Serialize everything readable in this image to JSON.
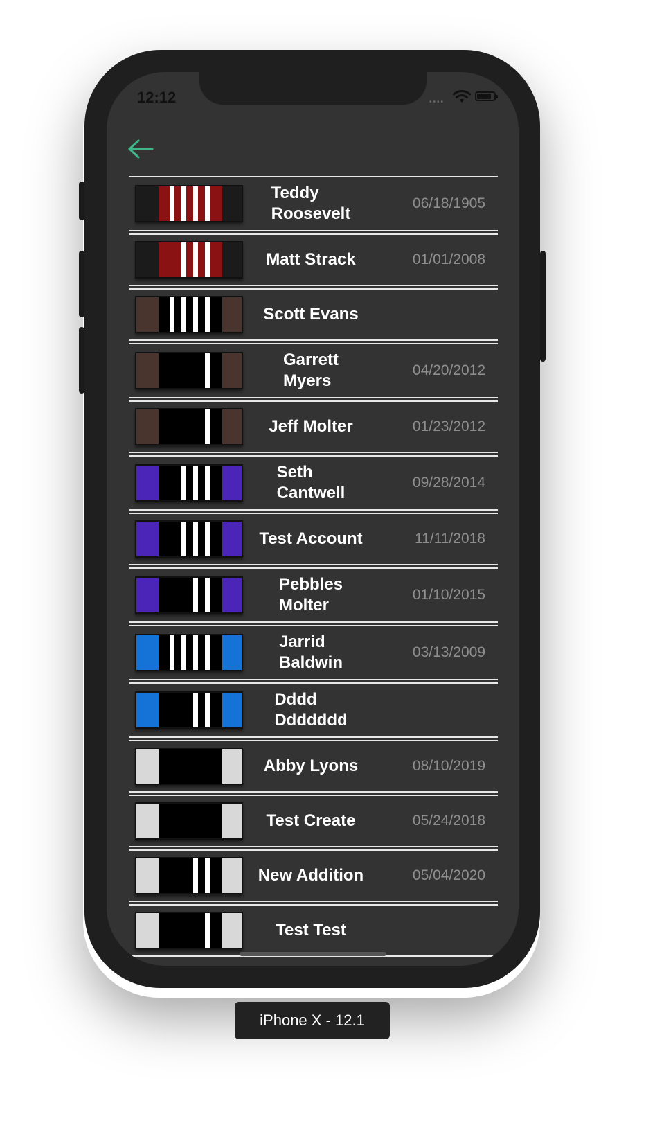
{
  "status_bar": {
    "time": "12:12",
    "signal_dots": "••••"
  },
  "colors": {
    "accent": "#3fb58a",
    "screen_bg": "#333333",
    "row_divider": "#e8e8e8",
    "name_text": "#ffffff",
    "date_text": "#8e8e8e",
    "belt_black": "#000000",
    "belt_dark_end": "#1b1b1b"
  },
  "belts": {
    "red": {
      "bar": "#8a1212",
      "ends": "#1b1b1b"
    },
    "brown": {
      "bar": "#000000",
      "ends": "#4a342e"
    },
    "purple": {
      "bar": "#000000",
      "ends": "#4a25b8"
    },
    "blue": {
      "bar": "#000000",
      "ends": "#1572d6"
    },
    "white": {
      "bar": "#000000",
      "ends": "#d8d8d8"
    }
  },
  "students": [
    {
      "name_line1": "Teddy",
      "name_line2": "Roosevelt",
      "date": "06/18/1905",
      "belt": "red",
      "stripes": 4
    },
    {
      "name_line1": "Matt Strack",
      "name_line2": "",
      "date": "01/01/2008",
      "belt": "red",
      "stripes": 3
    },
    {
      "name_line1": "Scott Evans",
      "name_line2": "",
      "date": "",
      "belt": "brown",
      "stripes": 4
    },
    {
      "name_line1": "Garrett",
      "name_line2": "Myers",
      "date": "04/20/2012",
      "belt": "brown",
      "stripes": 1
    },
    {
      "name_line1": "Jeff Molter",
      "name_line2": "",
      "date": "01/23/2012",
      "belt": "brown",
      "stripes": 1
    },
    {
      "name_line1": "Seth",
      "name_line2": "Cantwell",
      "date": "09/28/2014",
      "belt": "purple",
      "stripes": 3
    },
    {
      "name_line1": "Test Account",
      "name_line2": "",
      "date": "11/11/2018",
      "belt": "purple",
      "stripes": 3
    },
    {
      "name_line1": "Pebbles",
      "name_line2": "Molter",
      "date": "01/10/2015",
      "belt": "purple",
      "stripes": 2
    },
    {
      "name_line1": "Jarrid",
      "name_line2": "Baldwin",
      "date": "03/13/2009",
      "belt": "blue",
      "stripes": 4
    },
    {
      "name_line1": "Dddd",
      "name_line2": "Ddddddd",
      "date": "",
      "belt": "blue",
      "stripes": 2
    },
    {
      "name_line1": "Abby Lyons",
      "name_line2": "",
      "date": "08/10/2019",
      "belt": "white",
      "stripes": 0
    },
    {
      "name_line1": "Test Create",
      "name_line2": "",
      "date": "05/24/2018",
      "belt": "white",
      "stripes": 0
    },
    {
      "name_line1": "New Addition",
      "name_line2": "",
      "date": "05/04/2020",
      "belt": "white",
      "stripes": 2
    },
    {
      "name_line1": "Test Test",
      "name_line2": "",
      "date": "",
      "belt": "white",
      "stripes": 1
    }
  ],
  "icons": {
    "back": "arrow-left-icon",
    "wifi": "wifi-icon",
    "battery": "battery-icon"
  },
  "device_label": "iPhone X - 12.1"
}
